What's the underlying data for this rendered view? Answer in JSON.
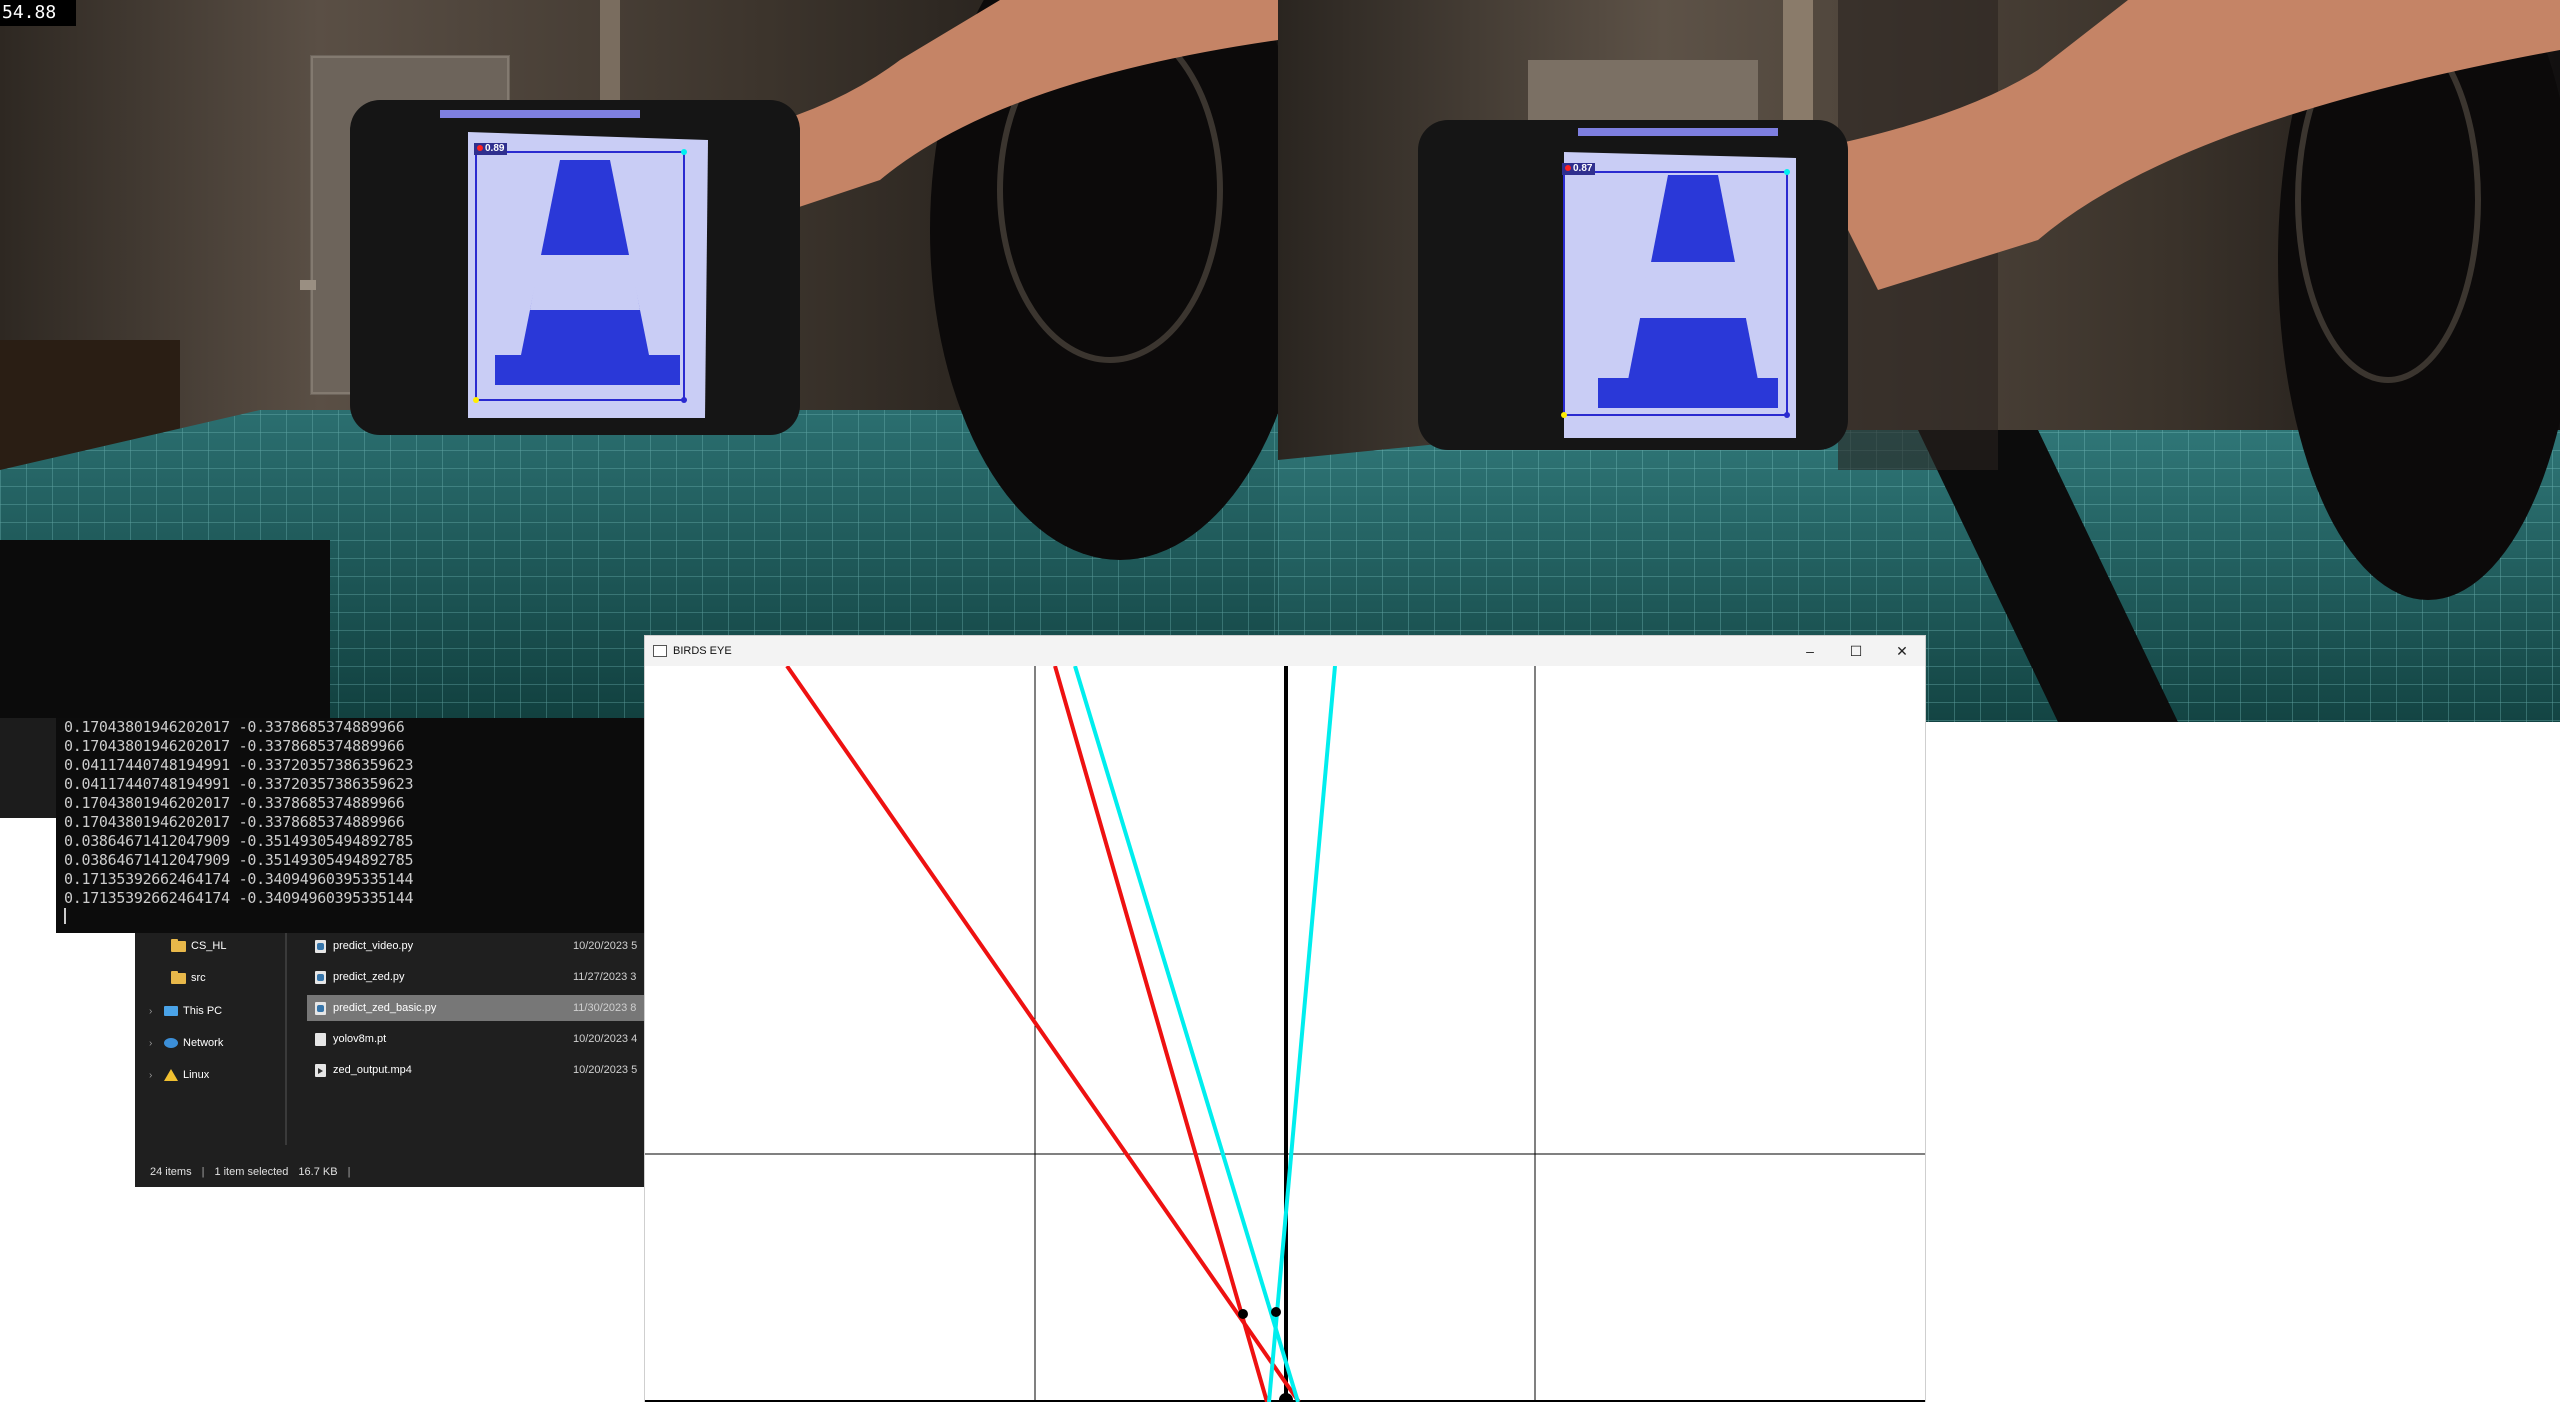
{
  "fps_overlay": "54.88",
  "left_camera": {
    "detection_confidence": "0.89",
    "bbox_color": "#2a2ad0"
  },
  "right_camera": {
    "detection_confidence": "0.87",
    "bbox_color": "#2a2ad0"
  },
  "terminal": {
    "lines": [
      "0.17043801946202017 -0.3378685374889966",
      "0.17043801946202017 -0.3378685374889966",
      "0.04117440748194991 -0.33720357386359623",
      "0.04117440748194991 -0.33720357386359623",
      "0.17043801946202017 -0.3378685374889966",
      "0.17043801946202017 -0.3378685374889966",
      "0.03864671412047909 -0.35149305494892785",
      "0.03864671412047909 -0.35149305494892785",
      "0.17135392662464174 -0.34094960395335144",
      "0.17135392662464174 -0.34094960395335144"
    ]
  },
  "explorer": {
    "nav": [
      {
        "label": "CS_HL",
        "icon": "folder-icon",
        "chevron": false
      },
      {
        "label": "src",
        "icon": "folder-icon",
        "chevron": false
      },
      {
        "label": "This PC",
        "icon": "computer-icon",
        "chevron": true
      },
      {
        "label": "Network",
        "icon": "network-icon",
        "chevron": true
      },
      {
        "label": "Linux",
        "icon": "linux-icon",
        "chevron": true
      }
    ],
    "files": [
      {
        "name": "predict_video.py",
        "date": "10/20/2023 5",
        "type": "py",
        "selected": false
      },
      {
        "name": "predict_zed.py",
        "date": "11/27/2023 3",
        "type": "py",
        "selected": false
      },
      {
        "name": "predict_zed_basic.py",
        "date": "11/30/2023 8",
        "type": "py",
        "selected": true
      },
      {
        "name": "yolov8m.pt",
        "date": "10/20/2023 4",
        "type": "file",
        "selected": false
      },
      {
        "name": "zed_output.mp4",
        "date": "10/20/2023 5",
        "type": "mp4",
        "selected": false
      }
    ],
    "status": {
      "items": "24 items",
      "selected": "1 item selected",
      "size": "16.7 KB",
      "sep": "|"
    }
  },
  "birds_eye": {
    "title": "BIRDS EYE",
    "minimize": "–",
    "maximize": "☐",
    "close": "✕",
    "colors": {
      "left_rays": "#ee1111",
      "right_rays": "#00eeee",
      "center": "#000000",
      "grid": "#000000"
    }
  }
}
